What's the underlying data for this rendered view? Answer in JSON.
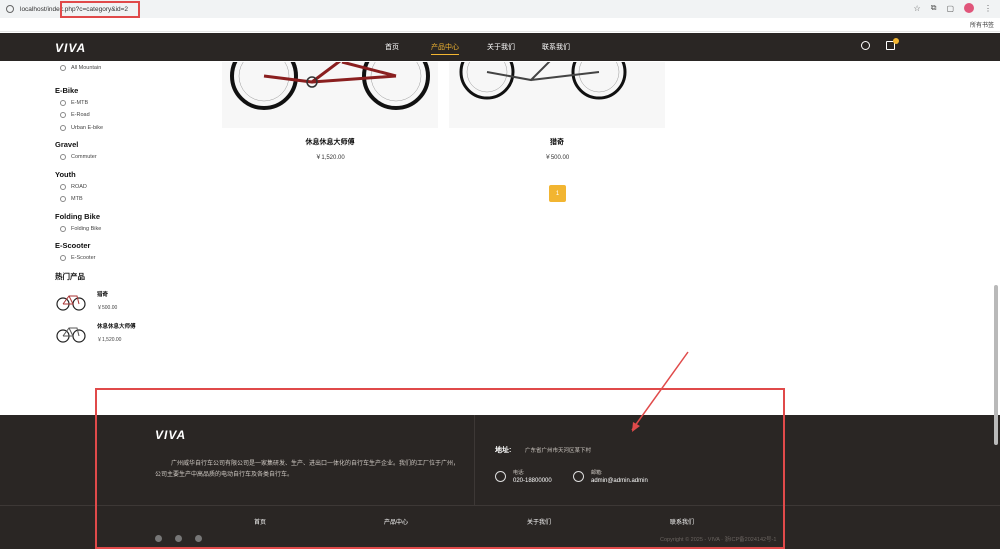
{
  "browser": {
    "url": "localhost/index.php?c=category&id=2",
    "bookmarks_label": "所有书签"
  },
  "header": {
    "logo": "VIVA",
    "nav": [
      "首页",
      "产品中心",
      "关于我们",
      "联系我们"
    ],
    "active_nav": "产品中心"
  },
  "sidebar": {
    "top_item": "All Mountain",
    "categories": [
      {
        "title": "E-Bike",
        "items": [
          "E-MTB",
          "E-Road",
          "Urban E-bike"
        ]
      },
      {
        "title": "Gravel",
        "items": [
          "Commuter"
        ]
      },
      {
        "title": "Youth",
        "items": [
          "ROAD",
          "MTB"
        ]
      },
      {
        "title": "Folding Bike",
        "items": [
          "Folding Bike"
        ]
      },
      {
        "title": "E-Scooter",
        "items": [
          "E-Scooter"
        ]
      }
    ],
    "hot_title": "热门产品",
    "hot_products": [
      {
        "name": "猎奇",
        "price": "￥500.00"
      },
      {
        "name": "休息休息大师傅",
        "price": "￥1,520.00"
      }
    ]
  },
  "products": [
    {
      "name": "休息休息大师傅",
      "price": "￥1,520.00"
    },
    {
      "name": "猎奇",
      "price": "￥500.00"
    }
  ],
  "pagination": {
    "current": "1"
  },
  "footer": {
    "logo": "VIVA",
    "description": "广州威华自行车公司有限公司是一家集研发、生产、进出口一体化的自行车生产企业。我们的工厂位于广州，公司主要生产中高品质的电动自行车及各类自行车。",
    "address_label": "地址:",
    "address": "广东省广州市天河区某下村",
    "phone_label": "电话:",
    "phone": "020-18800000",
    "email_label": "邮箱:",
    "email": "admin@admin.admin",
    "links": [
      "首页",
      "产品中心",
      "关于我们",
      "联系我们"
    ],
    "copyright": "Copyright © 2025 - VIVA · 浙ICP备2024142号-1"
  },
  "colors": {
    "accent": "#f2b531",
    "dark": "#2a2624",
    "annotation": "#e04a4a"
  }
}
